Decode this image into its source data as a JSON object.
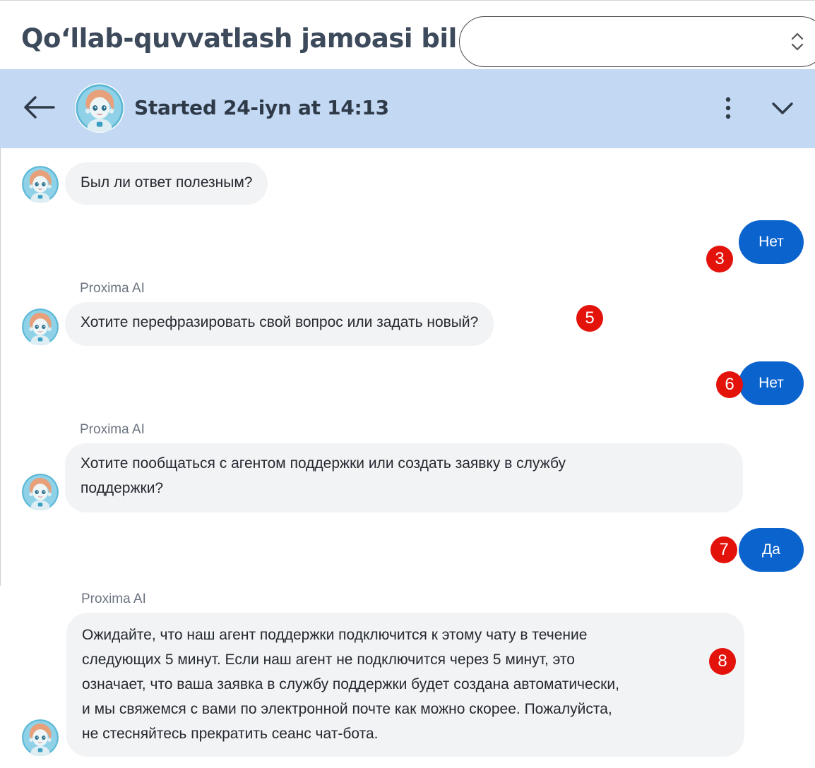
{
  "page": {
    "title": "Qo‘llab-quvvatlash jamoasi bil...",
    "select_value": ""
  },
  "chat_header": {
    "title": "Started 24-iyn at 14:13",
    "icons": [
      "back-arrow-icon",
      "bot-avatar",
      "more-vertical-icon",
      "chevron-down-icon"
    ],
    "header_color": "#c2d8f3"
  },
  "messages": [
    {
      "from": "bot",
      "text": "Был ли ответ полезным?"
    },
    {
      "from": "user",
      "text": "Нет",
      "badge": "3"
    },
    {
      "from": "bot",
      "sender": "Proxima AI",
      "text": "Хотите перефразировать свой вопрос или задать новый?",
      "badge": "5"
    },
    {
      "from": "user",
      "text": "Нет",
      "badge": "6"
    },
    {
      "from": "bot",
      "sender": "Proxima AI",
      "lines": [
        "Хотите пообщаться с агентом поддержки или создать заявку в службу",
        "поддержки?"
      ]
    },
    {
      "from": "user",
      "text": "Да",
      "badge": "7"
    },
    {
      "from": "bot",
      "sender": "Proxima AI",
      "badge": "8",
      "lines": [
        "Ожидайте, что наш агент поддержки подключится к этому чату в течение",
        "следующих 5 минут. Если наш агент не подключится через 5 минут, это",
        "означает, что ваша заявка в службу поддержки будет создана автоматически,",
        "и мы свяжемся с вами по электронной почте как можно скорее. Пожалуйста,",
        "не стесняйтесь прекратить сеанс чат-бота."
      ]
    }
  ],
  "colors": {
    "user_bubble": "#0b63ce",
    "bot_bubble": "#f2f3f5",
    "badge": "#e3120b"
  }
}
